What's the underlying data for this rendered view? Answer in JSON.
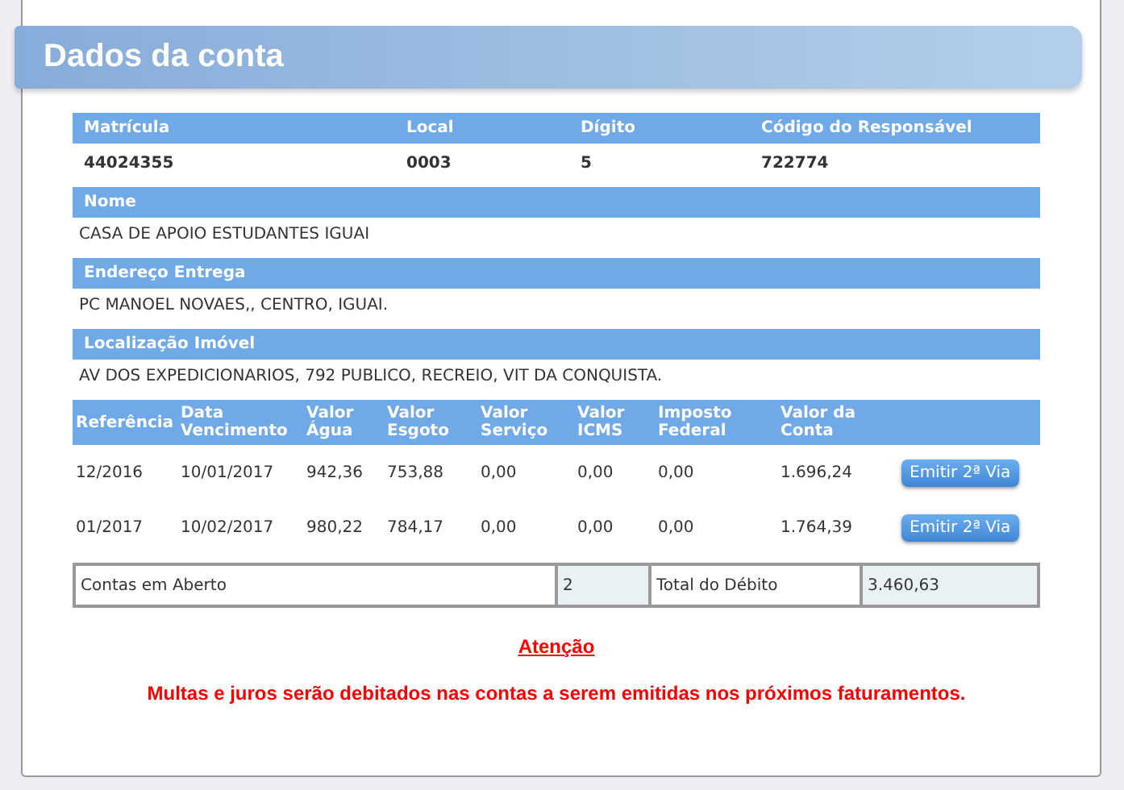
{
  "title": "Dados da conta",
  "account": {
    "columns": [
      "Matrícula",
      "Local",
      "Dígito",
      "Código do Responsável"
    ],
    "values": [
      "44024355",
      "0003",
      "5",
      "722774"
    ]
  },
  "fields": [
    {
      "label": "Nome",
      "value": "CASA DE APOIO ESTUDANTES IGUAI"
    },
    {
      "label": "Endereço Entrega",
      "value": "PC MANOEL NOVAES,, CENTRO, IGUAI."
    },
    {
      "label": "Localização Imóvel",
      "value": "AV DOS EXPEDICIONARIOS, 792 PUBLICO, RECREIO, VIT DA CONQUISTA."
    }
  ],
  "bills": {
    "columns": [
      "Referência",
      "Data Vencimento",
      "Valor Água",
      "Valor Esgoto",
      "Valor Serviço",
      "Valor ICMS",
      "Imposto Federal",
      "Valor da Conta"
    ],
    "rows": [
      {
        "cells": [
          "12/2016",
          "10/01/2017",
          "942,36",
          "753,88",
          "0,00",
          "0,00",
          "0,00",
          "1.696,24"
        ],
        "button": "Emitir 2ª Via"
      },
      {
        "cells": [
          "01/2017",
          "10/02/2017",
          "980,22",
          "784,17",
          "0,00",
          "0,00",
          "0,00",
          "1.764,39"
        ],
        "button": "Emitir 2ª Via"
      }
    ]
  },
  "totals": {
    "open_label": "Contas em Aberto",
    "open_count": "2",
    "total_label": "Total do Débito",
    "total_value": "3.460,63"
  },
  "notice": {
    "heading": "Atenção",
    "text": "Multas e juros serão debitados nas contas a serem emitidas nos próximos faturamentos."
  }
}
